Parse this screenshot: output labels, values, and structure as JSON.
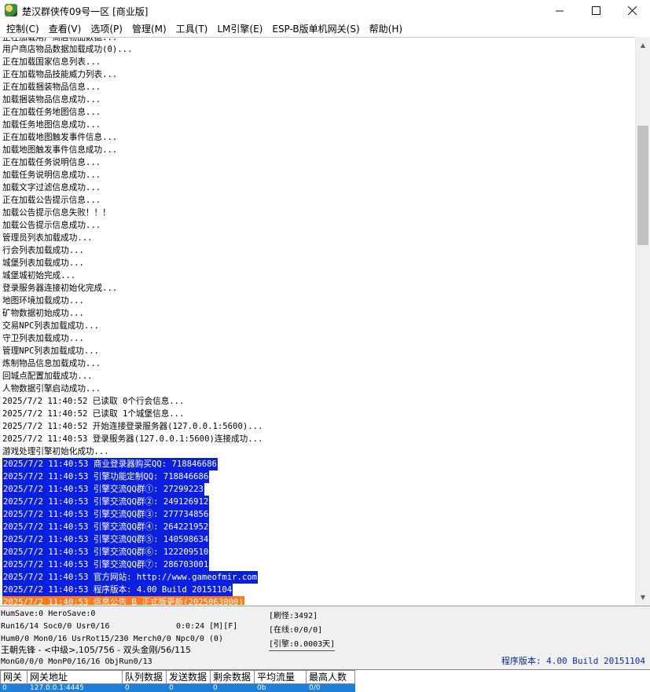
{
  "window": {
    "title": "楚汉群侠传09号一区 [商业版]",
    "minimize_glyph": "minimize-icon",
    "maximize_glyph": "maximize-icon",
    "close_glyph": "close-icon"
  },
  "menu": [
    "控制(C)",
    "查看(V)",
    "选项(P)",
    "管理(M)",
    "工具(T)",
    "LM引擎(E)",
    "ESP-B版单机网关(S)",
    "帮助(H)"
  ],
  "log": {
    "partial_top": "正在加载用户商店物品数据...",
    "lines": [
      {
        "text": "用户商店物品数据加载成功(0)..."
      },
      {
        "text": "正在加载国家信息列表..."
      },
      {
        "text": "正在加载物品技能威力列表..."
      },
      {
        "text": "正在加载捆装物品信息..."
      },
      {
        "text": "加载捆装物品信息成功..."
      },
      {
        "text": "正在加载任务地图信息..."
      },
      {
        "text": "加载任务地图信息成功..."
      },
      {
        "text": "正在加载地图触发事件信息..."
      },
      {
        "text": "加载地图触发事件信息成功..."
      },
      {
        "text": "正在加载任务说明信息..."
      },
      {
        "text": "加载任务说明信息成功..."
      },
      {
        "text": "加载文字过滤信息成功..."
      },
      {
        "text": "正在加载公告提示信息..."
      },
      {
        "text": "加载公告提示信息失败！！！"
      },
      {
        "text": "加载公告提示信息成功..."
      },
      {
        "text": "管理员列表加载成功..."
      },
      {
        "text": "行会列表加载成功..."
      },
      {
        "text": "城堡列表加载成功..."
      },
      {
        "text": "城堡城初始完成..."
      },
      {
        "text": "登录服务器连接初始化完成..."
      },
      {
        "text": "地图环境加载成功..."
      },
      {
        "text": "矿物数据初始成功..."
      },
      {
        "text": "交易NPC列表加载成功..."
      },
      {
        "text": "守卫列表加载成功..."
      },
      {
        "text": "管理NPC列表加载成功..."
      },
      {
        "text": "炼制物品信息加载成功..."
      },
      {
        "text": "回城点配置加载成功..."
      },
      {
        "text": "人物数据引擎启动成功..."
      },
      {
        "text": "2025/7/2 11:40:52 已读取 0个行会信息..."
      },
      {
        "text": "2025/7/2 11:40:52 已读取 1个城堡信息..."
      },
      {
        "text": "2025/7/2 11:40:52 开始连接登录服务器(127.0.0.1:5600)..."
      },
      {
        "text": "2025/7/2 11:40:53 登录服务器(127.0.0.1:5600)连接成功..."
      },
      {
        "text": "游戏处理引擎初始化成功..."
      },
      {
        "text": "2025/7/2 11:40:53 商业登录器购买QQ: 718846686",
        "hl": "blue"
      },
      {
        "text": "2025/7/2 11:40:53 引擎功能定制QQ: 718846686",
        "hl": "blue"
      },
      {
        "text": "2025/7/2 11:40:53 引擎交流QQ群①: 27299223",
        "hl": "blue"
      },
      {
        "text": "2025/7/2 11:40:53 引擎交流QQ群②: 249126912",
        "hl": "blue"
      },
      {
        "text": "2025/7/2 11:40:53 引擎交流QQ群③: 277734856",
        "hl": "blue"
      },
      {
        "text": "2025/7/2 11:40:53 引擎交流QQ群④: 264221952",
        "hl": "blue"
      },
      {
        "text": "2025/7/2 11:40:53 引擎交流QQ群⑤: 140598634",
        "hl": "blue"
      },
      {
        "text": "2025/7/2 11:40:53 引擎交流QQ群⑥: 122209510",
        "hl": "blue"
      },
      {
        "text": "2025/7/2 11:40:53 引擎交流QQ群⑦: 286703001",
        "hl": "blue"
      },
      {
        "text": "2025/7/2 11:40:53 官方网站: http://www.gameofmir.com",
        "hl": "blue"
      },
      {
        "text": "2025/7/2 11:40:53 程序版本: 4.00 Build 20151104",
        "hl": "blue"
      },
      {
        "text": "2025/7/2 11:40:53 信息公告 B 正式版更新(2025063000)",
        "hl": "orange"
      }
    ]
  },
  "status": {
    "line1": "HumSave:0 HeroSave:0",
    "line2": "Run16/14 Soc0/0 Usr0/16",
    "time": "0:0:24 [M][F]",
    "line3": "Hum0/0 Mon0/16 UsrRot15/230 Merch0/0 Npc0/0 (0)",
    "line4": "王朝先锋 - <中级>,105/756 - 双头金刚/56/115",
    "line5": "MonG0/0/0 MonP0/16/16 ObjRun0/13",
    "refresh": "[刷怪:3492]",
    "online": "[在线:0/0/0]",
    "engine": "[引擎:0.0003天]",
    "version": "程序版本: 4.00 Build 20151104"
  },
  "gateway": {
    "headers": [
      "网关",
      "网关地址",
      "队列数据",
      "发送数据",
      "剩余数据",
      "平均流量",
      "最高人数"
    ],
    "row": [
      "0",
      "127.0.0.1:4445",
      "0",
      "0",
      "0",
      "0b",
      "0/0"
    ]
  }
}
